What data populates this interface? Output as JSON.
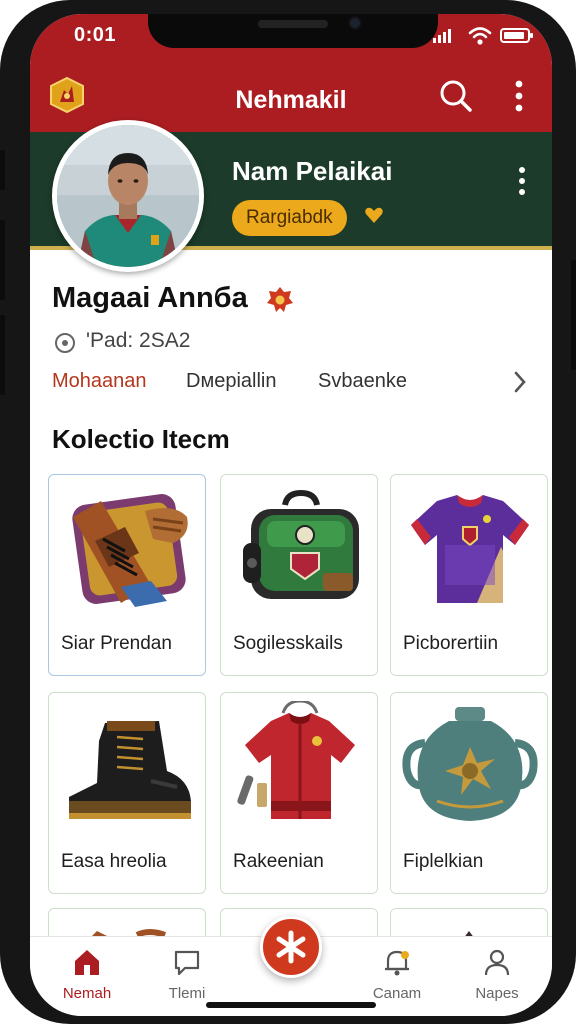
{
  "status_bar": {
    "time": "0:01"
  },
  "app_bar": {
    "title": "Nehmakil"
  },
  "profile": {
    "name": "Nam Pelaikai",
    "rank_badge": "Rargiabdk",
    "user_name": "Magaai Annба",
    "pad_label": "'Pad: 2SA2"
  },
  "tabs": [
    {
      "label": "Mohaanan",
      "active": true
    },
    {
      "label": "Dмepiallin",
      "active": false
    },
    {
      "label": "Svbaenke",
      "active": false
    }
  ],
  "section": {
    "title": "Kolectio Itecm"
  },
  "items": [
    {
      "label": "Siar Prendan",
      "icon": "leather-gloves-icon"
    },
    {
      "label": "Sogilesskails",
      "icon": "sports-bag-icon"
    },
    {
      "label": "Picborertiin",
      "icon": "jersey-icon"
    },
    {
      "label": "Easa hreolia",
      "icon": "boot-icon"
    },
    {
      "label": "Rakeenian",
      "icon": "red-shirt-icon"
    },
    {
      "label": "Fiplelkian",
      "icon": "ceramic-vase-icon"
    }
  ],
  "bottom_nav": [
    {
      "label": "Nemah",
      "icon": "home-icon",
      "active": true
    },
    {
      "label": "Tlemi",
      "icon": "chat-icon",
      "active": false
    },
    {
      "label": "Canam",
      "icon": "bell-icon",
      "active": false
    },
    {
      "label": "Napes",
      "icon": "user-icon",
      "active": false
    }
  ],
  "colors": {
    "brand_red": "#ac1d22",
    "banner_green": "#1c3b2a",
    "badge_gold": "#eca91c",
    "accent_orange": "#cf3a1e"
  }
}
